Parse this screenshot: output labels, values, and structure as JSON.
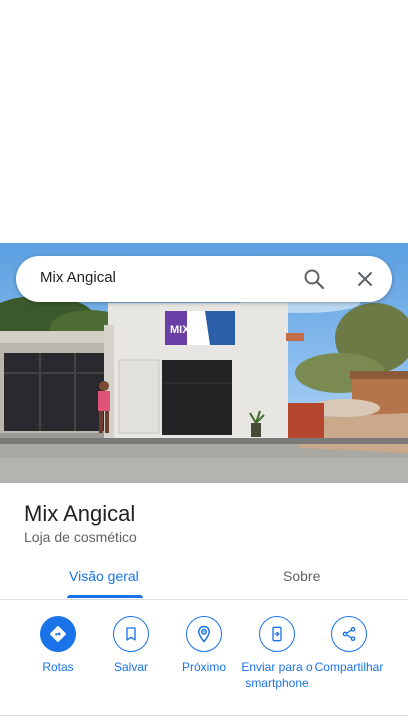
{
  "search": {
    "query": "Mix Angical",
    "icons": [
      "search-icon",
      "close-icon"
    ]
  },
  "photo": {
    "sign_text": "MIX"
  },
  "place": {
    "name": "Mix Angical",
    "category": "Loja de cosmético"
  },
  "tabs": [
    {
      "label": "Visão geral",
      "selected": true
    },
    {
      "label": "Sobre",
      "selected": false
    }
  ],
  "actions": [
    {
      "label": "Rotas",
      "icon": "directions-icon",
      "primary": true
    },
    {
      "label": "Salvar",
      "icon": "bookmark-icon",
      "primary": false
    },
    {
      "label": "Próximo",
      "icon": "nearby-icon",
      "primary": false
    },
    {
      "label": "Enviar para o smartphone",
      "icon": "send-to-phone-icon",
      "primary": false
    },
    {
      "label": "Compartilhar",
      "icon": "share-icon",
      "primary": false
    }
  ],
  "colors": {
    "accent": "#1a73e8",
    "text_primary": "#202124",
    "text_secondary": "#5f6368",
    "divider": "#dadce0"
  }
}
